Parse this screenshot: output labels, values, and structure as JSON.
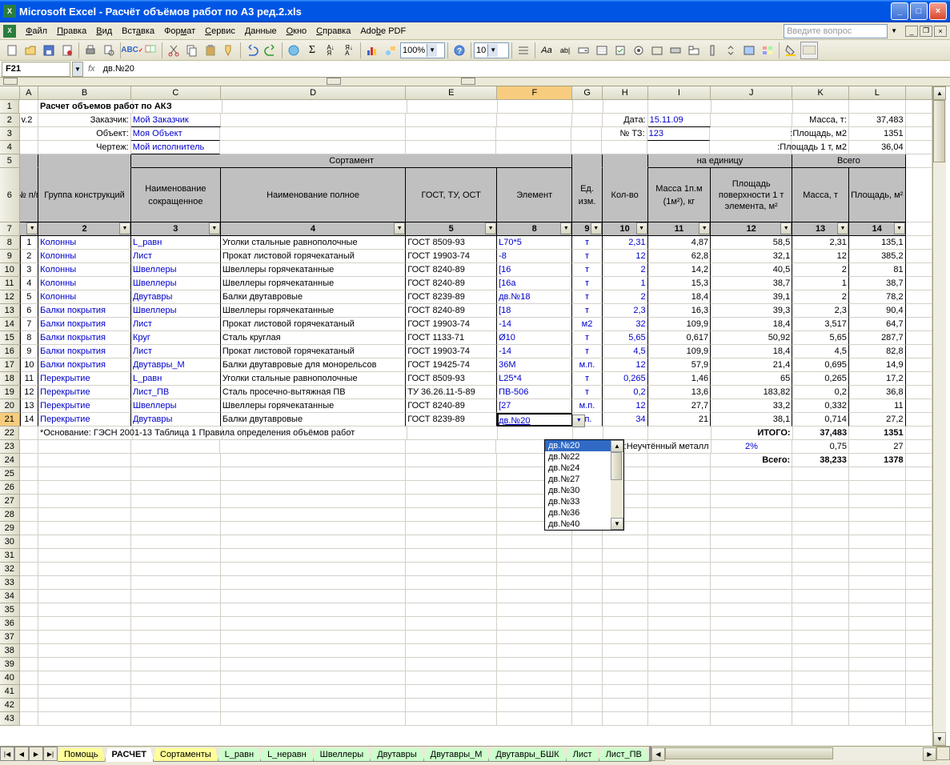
{
  "titlebar": {
    "text": "Microsoft Excel - Расчёт объёмов работ по А3 ред.2.xls"
  },
  "menu": {
    "items": [
      "Файл",
      "Правка",
      "Вид",
      "Вставка",
      "Формат",
      "Сервис",
      "Данные",
      "Окно",
      "Справка",
      "Adobe PDF"
    ],
    "question_placeholder": "Введите вопрос"
  },
  "toolbar1": {
    "zoom": "100%"
  },
  "toolbar2": {
    "fontsize": "10"
  },
  "formula": {
    "namebox": "F21",
    "formula": "дв.№20"
  },
  "columns": [
    "A",
    "B",
    "C",
    "D",
    "E",
    "F",
    "G",
    "H",
    "I",
    "J",
    "K",
    "L"
  ],
  "sheet": {
    "title": "Расчет объемов работ по АКЗ",
    "version": "v.2",
    "labels": {
      "customer": "Заказчик:",
      "object": "Объект:",
      "drawing": "Чертеж:",
      "date": "Дата:",
      "tz": "№ ТЗ:",
      "mass_t": "Масса, т:",
      "area_m2": "Площадь, м2:",
      "area1t": "Площадь 1 т, м2:",
      "sortament": "Сортамент",
      "per_unit": "на единицу",
      "total": "Всего",
      "np": "№ п/п",
      "group": "Группа конструкций",
      "name_short": "Наименование сокращенное",
      "name_full": "Наименование полное",
      "gost": "ГОСТ, ТУ, ОСТ",
      "element": "Элемент",
      "unit": "Ед. изм.",
      "qty": "Кол-во",
      "mass1pm": "Масса 1п.м (1м²), кг",
      "surf1t": "Площадь поверхности 1 т элемента, м²",
      "mass": "Масса, т",
      "area": "Площадь, м²"
    },
    "vals": {
      "customer": "Мой Заказчик",
      "object": "Моя Объект",
      "drawing": "Мой исполнитель",
      "date": "15.11.09",
      "tz": "123",
      "mass_t": "37,483",
      "area_m2": "1351",
      "area1t": "36,04"
    },
    "filter_row": [
      "1",
      "2",
      "3",
      "4",
      "5",
      "8",
      "9",
      "10",
      "11",
      "12",
      "13",
      "14"
    ],
    "rows": [
      {
        "n": "1",
        "grp": "Колонны",
        "short": "L_равн",
        "full": "Уголки стальные равнополочные",
        "gost": "ГОСТ 8509-93",
        "el": "L70*5",
        "u": "т",
        "q": "2,31",
        "m1": "4,87",
        "s1": "58,5",
        "m": "2,31",
        "s": "135,1"
      },
      {
        "n": "2",
        "grp": "Колонны",
        "short": "Лист",
        "full": "Прокат листовой горячекатаный",
        "gost": "ГОСТ 19903-74",
        "el": "-8",
        "u": "т",
        "q": "12",
        "m1": "62,8",
        "s1": "32,1",
        "m": "12",
        "s": "385,2"
      },
      {
        "n": "3",
        "grp": "Колонны",
        "short": "Швеллеры",
        "full": "Швеллеры горячекатанные",
        "gost": "ГОСТ 8240-89",
        "el": "[16",
        "u": "т",
        "q": "2",
        "m1": "14,2",
        "s1": "40,5",
        "m": "2",
        "s": "81"
      },
      {
        "n": "4",
        "grp": "Колонны",
        "short": "Швеллеры",
        "full": "Швеллеры горячекатанные",
        "gost": "ГОСТ 8240-89",
        "el": "[16a",
        "u": "т",
        "q": "1",
        "m1": "15,3",
        "s1": "38,7",
        "m": "1",
        "s": "38,7"
      },
      {
        "n": "5",
        "grp": "Колонны",
        "short": "Двутавры",
        "full": "Балки двутавровые",
        "gost": "ГОСТ 8239-89",
        "el": "дв.№18",
        "u": "т",
        "q": "2",
        "m1": "18,4",
        "s1": "39,1",
        "m": "2",
        "s": "78,2"
      },
      {
        "n": "6",
        "grp": "Балки покрытия",
        "short": "Швеллеры",
        "full": "Швеллеры горячекатанные",
        "gost": "ГОСТ 8240-89",
        "el": "[18",
        "u": "т",
        "q": "2,3",
        "m1": "16,3",
        "s1": "39,3",
        "m": "2,3",
        "s": "90,4"
      },
      {
        "n": "7",
        "grp": "Балки покрытия",
        "short": "Лист",
        "full": "Прокат листовой горячекатаный",
        "gost": "ГОСТ 19903-74",
        "el": "-14",
        "u": "м2",
        "q": "32",
        "m1": "109,9",
        "s1": "18,4",
        "m": "3,517",
        "s": "64,7"
      },
      {
        "n": "8",
        "grp": "Балки покрытия",
        "short": "Круг",
        "full": "Сталь круглая",
        "gost": "ГОСТ 1133-71",
        "el": "Ø10",
        "u": "т",
        "q": "5,65",
        "m1": "0,617",
        "s1": "50,92",
        "m": "5,65",
        "s": "287,7"
      },
      {
        "n": "9",
        "grp": "Балки покрытия",
        "short": "Лист",
        "full": "Прокат листовой горячекатаный",
        "gost": "ГОСТ 19903-74",
        "el": "-14",
        "u": "т",
        "q": "4,5",
        "m1": "109,9",
        "s1": "18,4",
        "m": "4,5",
        "s": "82,8"
      },
      {
        "n": "10",
        "grp": "Балки покрытия",
        "short": "Двутавры_М",
        "full": "Балки двутавровые для монорельсов",
        "gost": "ГОСТ 19425-74",
        "el": "36М",
        "u": "м.п.",
        "q": "12",
        "m1": "57,9",
        "s1": "21,4",
        "m": "0,695",
        "s": "14,9"
      },
      {
        "n": "11",
        "grp": "Перекрытие",
        "short": "L_равн",
        "full": "Уголки стальные равнополочные",
        "gost": "ГОСТ 8509-93",
        "el": "L25*4",
        "u": "т",
        "q": "0,265",
        "m1": "1,46",
        "s1": "65",
        "m": "0,265",
        "s": "17,2"
      },
      {
        "n": "12",
        "grp": "Перекрытие",
        "short": "Лист_ПВ",
        "full": "Сталь просечно-вытяжная ПВ",
        "gost": "ТУ 36.26.11-5-89",
        "el": "ПВ-506",
        "u": "т",
        "q": "0,2",
        "m1": "13,6",
        "s1": "183,82",
        "m": "0,2",
        "s": "36,8"
      },
      {
        "n": "13",
        "grp": "Перекрытие",
        "short": "Швеллеры",
        "full": "Швеллеры горячекатанные",
        "gost": "ГОСТ 8240-89",
        "el": "[27",
        "u": "м.п.",
        "q": "12",
        "m1": "27,7",
        "s1": "33,2",
        "m": "0,332",
        "s": "11"
      },
      {
        "n": "14",
        "grp": "Перекрытие",
        "short": "Двутавры",
        "full": "Балки двутавровые",
        "gost": "ГОСТ 8239-89",
        "el": "дв.№20",
        "u": ".п.",
        "q": "34",
        "m1": "21",
        "s1": "38,1",
        "m": "0,714",
        "s": "27,2"
      }
    ],
    "footer": {
      "note": "*Основание: ГЭСН 2001-13 Таблица 1 Правила определения объёмов работ",
      "itogo_label": "ИТОГО:",
      "itogo_mass": "37,483",
      "itogo_area": "1351",
      "unmetal_label": "Неучтённый металл:",
      "unmetal_pct": "2%",
      "unmetal_mass": "0,75",
      "unmetal_area": "27",
      "vsego_label": "Всего:",
      "vsego_mass": "38,233",
      "vsego_area": "1378"
    },
    "dropdown": [
      "дв.№20",
      "дв.№22",
      "дв.№24",
      "дв.№27",
      "дв.№30",
      "дв.№33",
      "дв.№36",
      "дв.№40"
    ]
  },
  "tabs": [
    "Помощь",
    "РАСЧЕТ",
    "Сортаменты",
    "L_равн",
    "L_неравн",
    "Швеллеры",
    "Двутавры",
    "Двутавры_М",
    "Двутавры_БШК",
    "Лист",
    "Лист_ПВ"
  ]
}
